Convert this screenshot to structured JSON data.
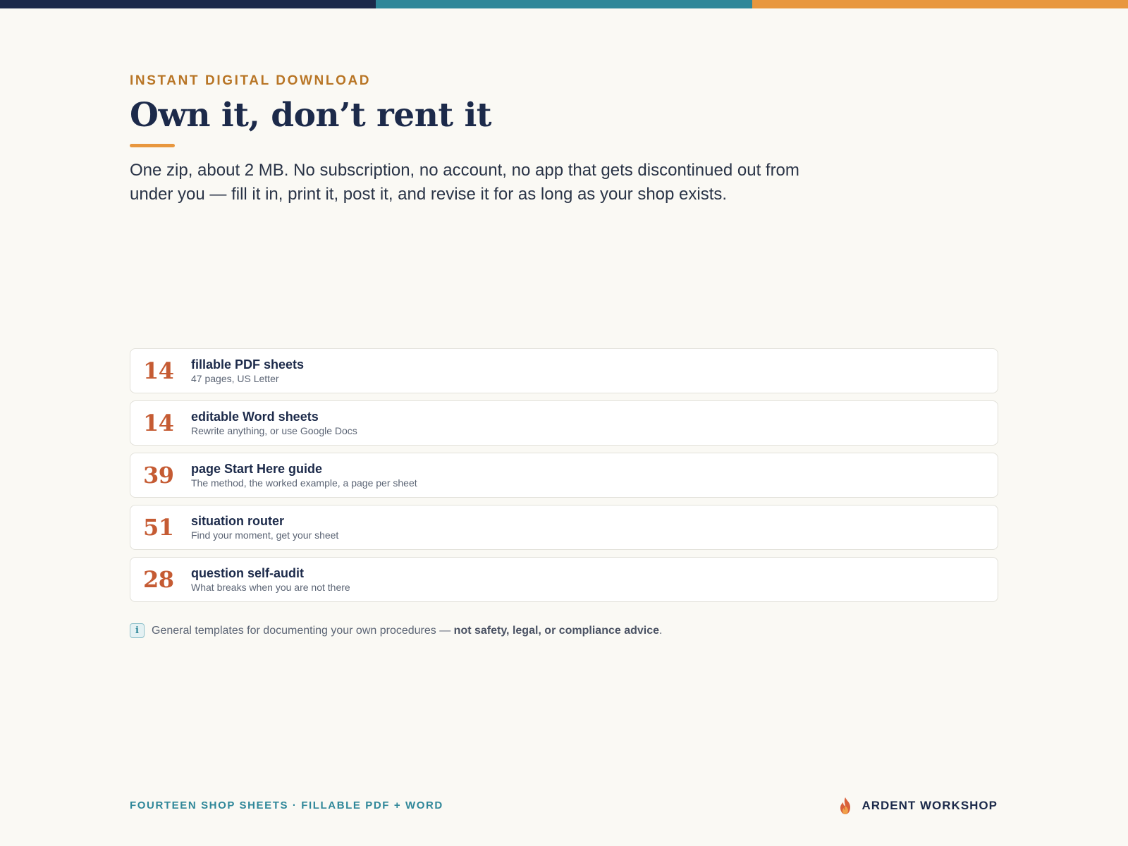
{
  "hero": {
    "eyebrow": "INSTANT DIGITAL DOWNLOAD",
    "title": "Own it, don’t rent it",
    "lede": "One zip, about 2 MB. No subscription, no account, no app that gets discontinued out from under you — fill it in, print it, post it, and revise it for as long as your shop exists."
  },
  "stats": [
    {
      "number": "14",
      "label": "fillable PDF sheets",
      "sub": "47 pages, US Letter"
    },
    {
      "number": "14",
      "label": "editable Word sheets",
      "sub": "Rewrite anything, or use Google Docs"
    },
    {
      "number": "39",
      "label": "page Start Here guide",
      "sub": "The method, the worked example, a page per sheet"
    },
    {
      "number": "51",
      "label": "situation router",
      "sub": "Find your moment, get your sheet"
    },
    {
      "number": "28",
      "label": "question self-audit",
      "sub": "What breaks when you are not there"
    }
  ],
  "note": {
    "icon": "info-icon",
    "icon_glyph": "i",
    "text": "General templates for documenting your own procedures — ",
    "emphasis": "not safety, legal, or compliance advice",
    "end": "."
  },
  "footer": {
    "left": "FOURTEEN SHOP SHEETS · FILLABLE PDF + WORD",
    "brand_icon": "flame-icon",
    "brand": "ARDENT WORKSHOP"
  },
  "colors": {
    "navy": "#1c2a4a",
    "teal": "#2f8799",
    "orange": "#e8973e",
    "rust": "#c55b33",
    "background": "#faf9f4"
  }
}
